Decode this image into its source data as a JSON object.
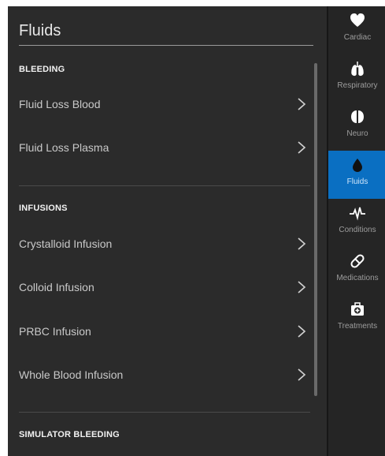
{
  "main": {
    "title": "Fluids",
    "sections": [
      {
        "heading": "BLEEDING",
        "items": [
          "Fluid Loss Blood",
          "Fluid Loss Plasma"
        ]
      },
      {
        "heading": "INFUSIONS",
        "items": [
          "Crystalloid Infusion",
          "Colloid Infusion",
          "PRBC Infusion",
          "Whole Blood Infusion"
        ]
      },
      {
        "heading": "SIMULATOR BLEEDING",
        "items": []
      }
    ]
  },
  "rail": {
    "items": [
      {
        "label": "Cardiac",
        "icon": "heart-icon"
      },
      {
        "label": "Respiratory",
        "icon": "lungs-icon"
      },
      {
        "label": "Neuro",
        "icon": "brain-icon"
      },
      {
        "label": "Fluids",
        "icon": "drop-icon",
        "active": true
      },
      {
        "label": "Conditions",
        "icon": "pulse-icon"
      },
      {
        "label": "Medications",
        "icon": "pill-icon"
      },
      {
        "label": "Treatments",
        "icon": "medkit-icon"
      }
    ]
  },
  "colors": {
    "accent": "#0a6fc2",
    "background": "#2b2b2b",
    "rail": "#252525"
  }
}
